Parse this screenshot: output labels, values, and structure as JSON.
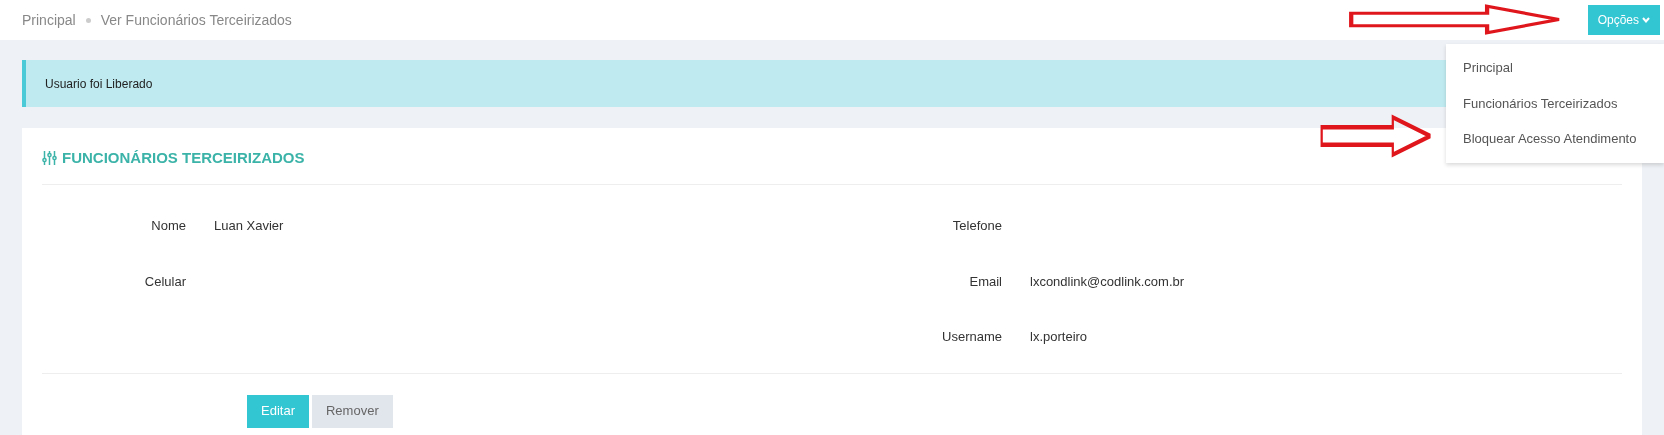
{
  "breadcrumb": [
    "Principal",
    "Ver Funcionários Terceirizados"
  ],
  "options_button": {
    "label": "Opções"
  },
  "options_menu": [
    "Principal",
    "Funcionários Terceirizados",
    "Bloquear Acesso Atendimento"
  ],
  "alert": "Usuario foi Liberado",
  "card": {
    "title": "FUNCIONÁRIOS TERCEIRIZADOS",
    "rows": [
      {
        "left": {
          "label": "Nome",
          "value": "Luan Xavier"
        },
        "right": {
          "label": "Telefone"
        }
      },
      {
        "left": {
          "label": "Celular"
        },
        "right": {
          "label": "Email",
          "value": "lxcondlink@codlink.com.br"
        }
      },
      {
        "right": {
          "label": "Username",
          "value": "lx.porteiro"
        }
      }
    ],
    "buttons": [
      {
        "label": "Editar",
        "kind": "primary"
      },
      {
        "label": "Remover",
        "kind": "secondary"
      }
    ]
  }
}
